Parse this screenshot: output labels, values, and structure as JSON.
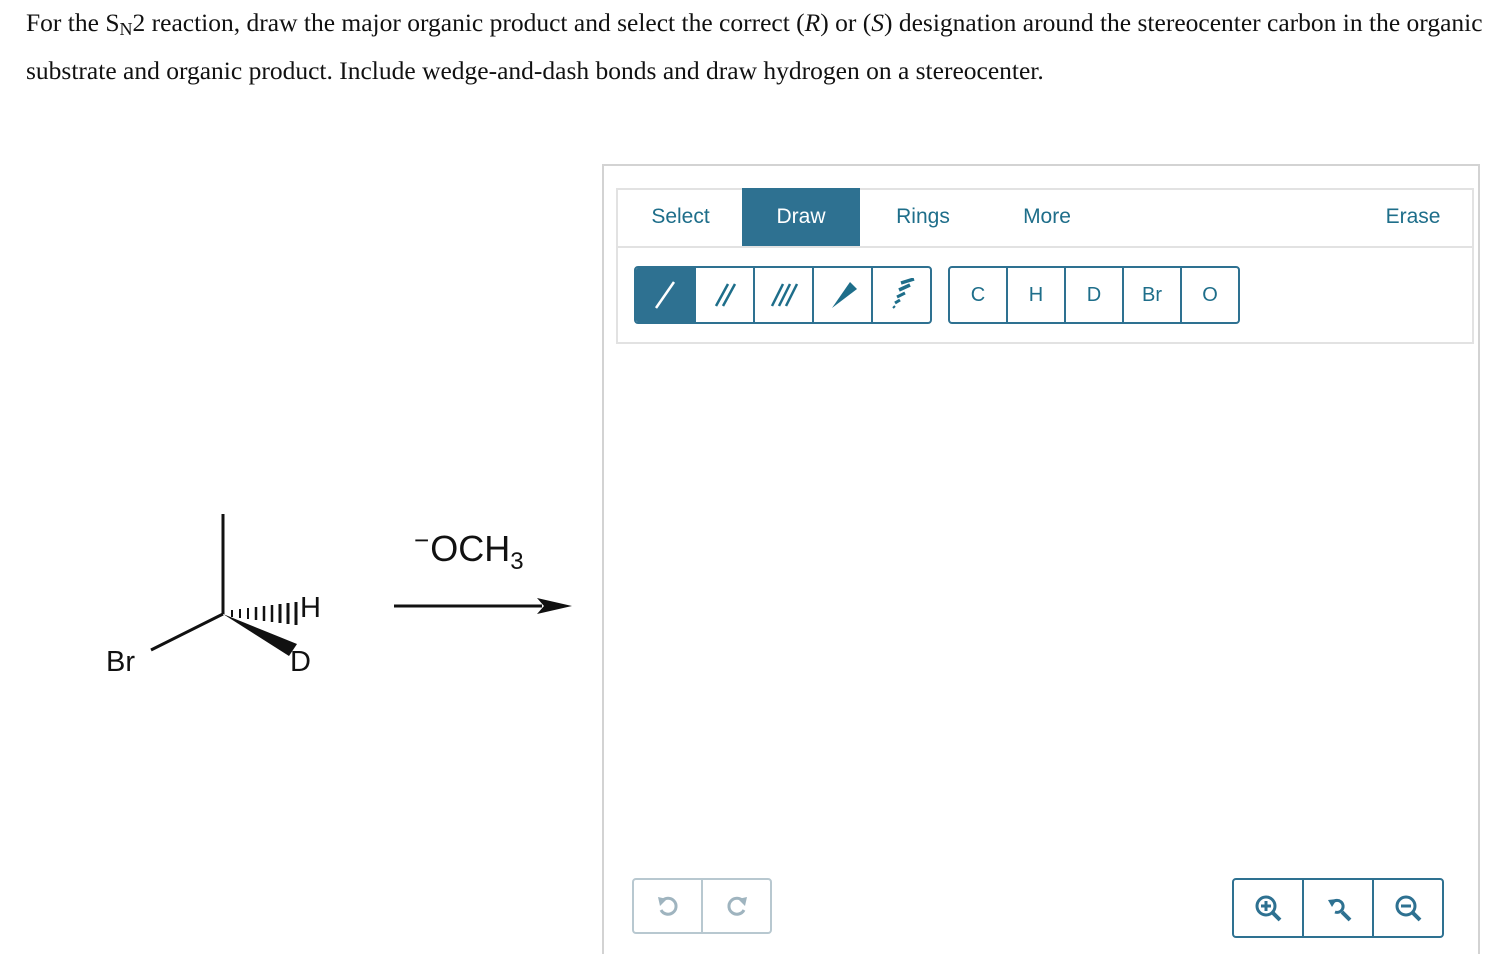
{
  "question": {
    "part1": "For the S",
    "sub": "N",
    "part2": "2 reaction, draw the major organic product and select the correct (",
    "r": "R",
    "part3": ") or (",
    "s": "S",
    "part4": ") designation around the stereocenter carbon in the organic substrate and organic product. Include wedge-and-dash bonds and draw hydrogen on a stereocenter."
  },
  "scheme": {
    "substrate": {
      "br": "Br",
      "h": "H",
      "d": "D"
    },
    "reagent": {
      "charge": "−",
      "formula": "OCH",
      "subscript": "3"
    }
  },
  "widget": {
    "tabs": [
      "Select",
      "Draw",
      "Rings",
      "More",
      "Erase"
    ],
    "active_tab": "Draw",
    "bond_tools": [
      "single-bond",
      "double-bond",
      "triple-bond",
      "wedge-bond",
      "dash-bond"
    ],
    "active_bond_tool": "single-bond",
    "atoms": [
      "C",
      "H",
      "D",
      "Br",
      "O"
    ],
    "accent_color": "#2e7191",
    "text_color": "#1e6e8a"
  }
}
